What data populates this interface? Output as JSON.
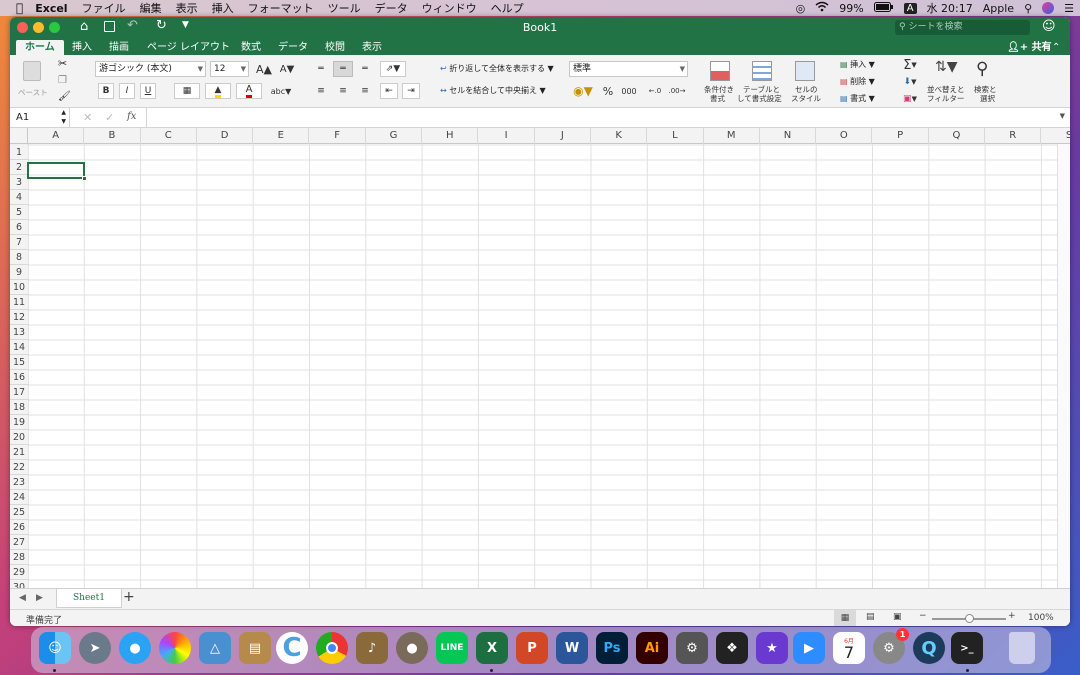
{
  "menubar": {
    "app": "Excel",
    "items": [
      "ファイル",
      "編集",
      "表示",
      "挿入",
      "フォーマット",
      "ツール",
      "データ",
      "ウィンドウ",
      "ヘルプ"
    ],
    "battery": "99%",
    "input_source": "A",
    "clock": "水 20:17",
    "user": "Apple"
  },
  "window": {
    "title": "Book1",
    "search_placeholder": "シートを検索",
    "share_label": "共有"
  },
  "ribbon_tabs": [
    "ホーム",
    "挿入",
    "描画",
    "ページ レイアウト",
    "数式",
    "データ",
    "校閲",
    "表示"
  ],
  "ribbon": {
    "paste_label": "ペースト",
    "font_name": "游ゴシック (本文)",
    "font_size": "12",
    "bold": "B",
    "italic": "I",
    "underline": "U",
    "wrap_text": "折り返して全体を表示する",
    "merge_center": "セルを結合して中央揃え",
    "number_format": "標準",
    "percent": "%",
    "thousands": "000",
    "cond_format": [
      "条件付き",
      "書式"
    ],
    "format_table": [
      "テーブルと",
      "して書式設定"
    ],
    "cell_styles": [
      "セルの",
      "スタイル"
    ],
    "insert": "挿入",
    "delete": "削除",
    "format": "書式",
    "sort_filter": [
      "並べ替えと",
      "フィルター"
    ],
    "find_select": [
      "検索と",
      "選択"
    ]
  },
  "formula_bar": {
    "name_box": "A1",
    "fx": "fx",
    "value": ""
  },
  "grid": {
    "columns": [
      "A",
      "B",
      "C",
      "D",
      "E",
      "F",
      "G",
      "H",
      "I",
      "J",
      "K",
      "L",
      "M",
      "N",
      "O",
      "P",
      "Q",
      "R",
      "S"
    ],
    "rows": [
      "1",
      "2",
      "3",
      "4",
      "5",
      "6",
      "7",
      "8",
      "9",
      "10",
      "11",
      "12",
      "13",
      "14",
      "15",
      "16",
      "17",
      "18",
      "19",
      "20",
      "21",
      "22",
      "23",
      "24",
      "25",
      "26",
      "27",
      "28",
      "29",
      "30"
    ],
    "selected_cell": "A1"
  },
  "sheet_tabs": {
    "active": "Sheet1",
    "add": "+"
  },
  "status": {
    "ready": "準備完了",
    "zoom": "100%"
  },
  "dock": {
    "calendar_day": "7",
    "calendar_month": "6月",
    "settings_badge": "1",
    "apps": [
      "finder-icon",
      "launchpad-icon",
      "messages-icon",
      "photos-icon",
      "preview-icon",
      "notes-icon",
      "cursor-app-icon",
      "chrome-icon",
      "instruments-icon",
      "gimp-icon",
      "line-icon",
      "excel-icon",
      "powerpoint-icon",
      "word-icon",
      "photoshop-icon",
      "illustrator-icon",
      "disk-utility-icon",
      "final-cut-icon",
      "imovie-icon",
      "zoom-icon",
      "calendar-icon",
      "system-preferences-icon",
      "quicktime-icon",
      "terminal-icon",
      "trash-icon"
    ],
    "labels": {
      "line": "LINE",
      "photoshop": "Ps",
      "illustrator": "Ai",
      "excel": "X",
      "powerpoint": "P",
      "word": "W"
    }
  },
  "colors": {
    "excel_green": "#217346",
    "selection": "#217346"
  }
}
